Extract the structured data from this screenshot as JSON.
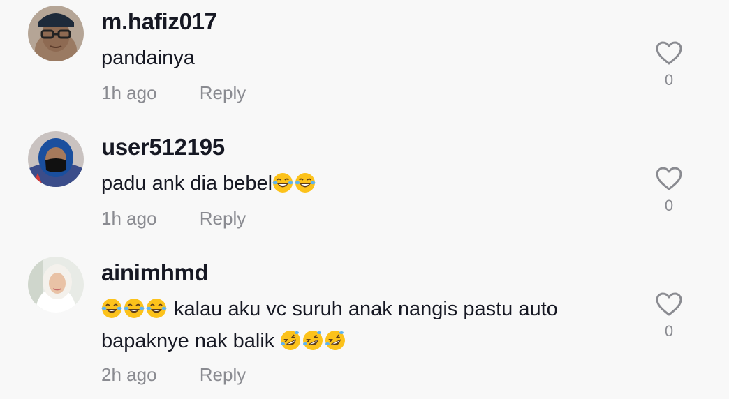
{
  "comments": [
    {
      "username": "m.hafiz017",
      "text": "pandainya",
      "emojis_after": [],
      "emojis_before": [],
      "time": "1h ago",
      "reply_label": "Reply",
      "likes": "0",
      "avatar_icon": "avatar-man-glasses-cap"
    },
    {
      "username": "user512195",
      "text": "padu ank dia bebel",
      "emojis_after": [
        "face-with-tears-of-joy",
        "face-with-tears-of-joy"
      ],
      "emojis_before": [],
      "time": "1h ago",
      "reply_label": "Reply",
      "likes": "0",
      "avatar_icon": "avatar-woman-hijab-mask"
    },
    {
      "username": "ainimhmd",
      "text": " kalau aku vc suruh anak nangis pastu auto bapaknye nak balik ",
      "emojis_before": [
        "face-with-tears-of-joy",
        "face-with-tears-of-joy",
        "face-with-tears-of-joy"
      ],
      "emojis_after": [
        "rolling-on-the-floor-laughing",
        "rolling-on-the-floor-laughing",
        "rolling-on-the-floor-laughing"
      ],
      "time": "2h ago",
      "reply_label": "Reply",
      "likes": "0",
      "avatar_icon": "avatar-woman-white-hijab"
    }
  ],
  "colors": {
    "background": "#f8f8f8",
    "username": "#161823",
    "meta": "#8a8b91",
    "emoji_face": "#fcc21b"
  }
}
